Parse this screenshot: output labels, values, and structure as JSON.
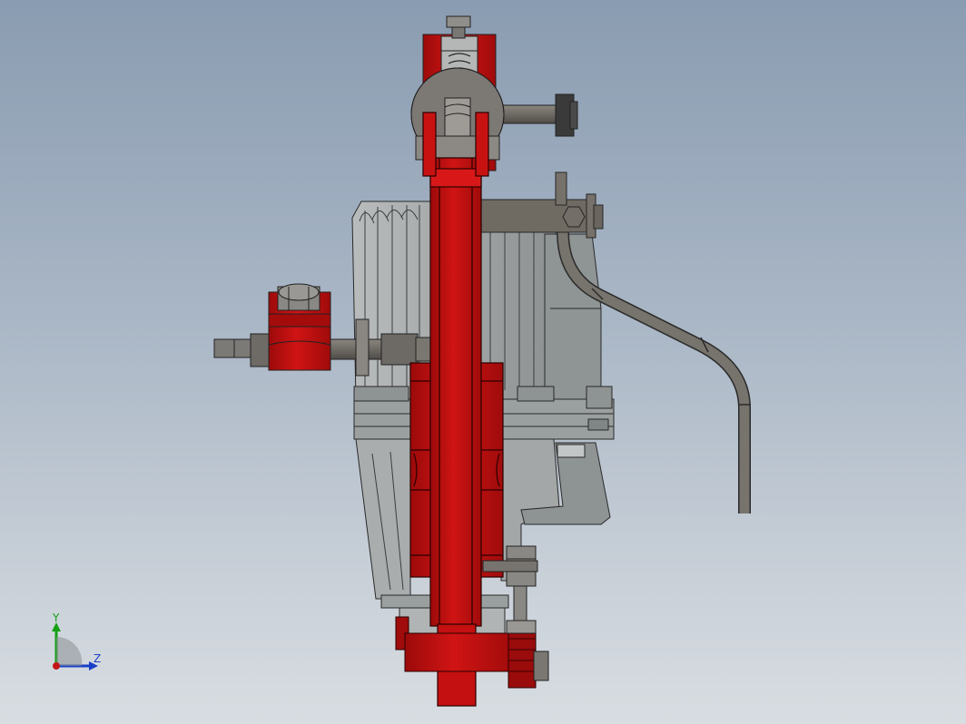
{
  "view": {
    "background_top": "#8a9cb1",
    "background_bottom": "#d8dde2"
  },
  "colors": {
    "red_part": "#c40e0e",
    "red_dark": "#8e0707",
    "grey_housing": "#9ea2a3",
    "grey_dark": "#6f7373",
    "steel_rod": "#6b6762",
    "outline": "#1e1e1e"
  },
  "triad": {
    "y_label": "Y",
    "z_label": "Z",
    "y_color": "#15a015",
    "z_color": "#1a3fc8",
    "origin_color": "#c41616"
  }
}
